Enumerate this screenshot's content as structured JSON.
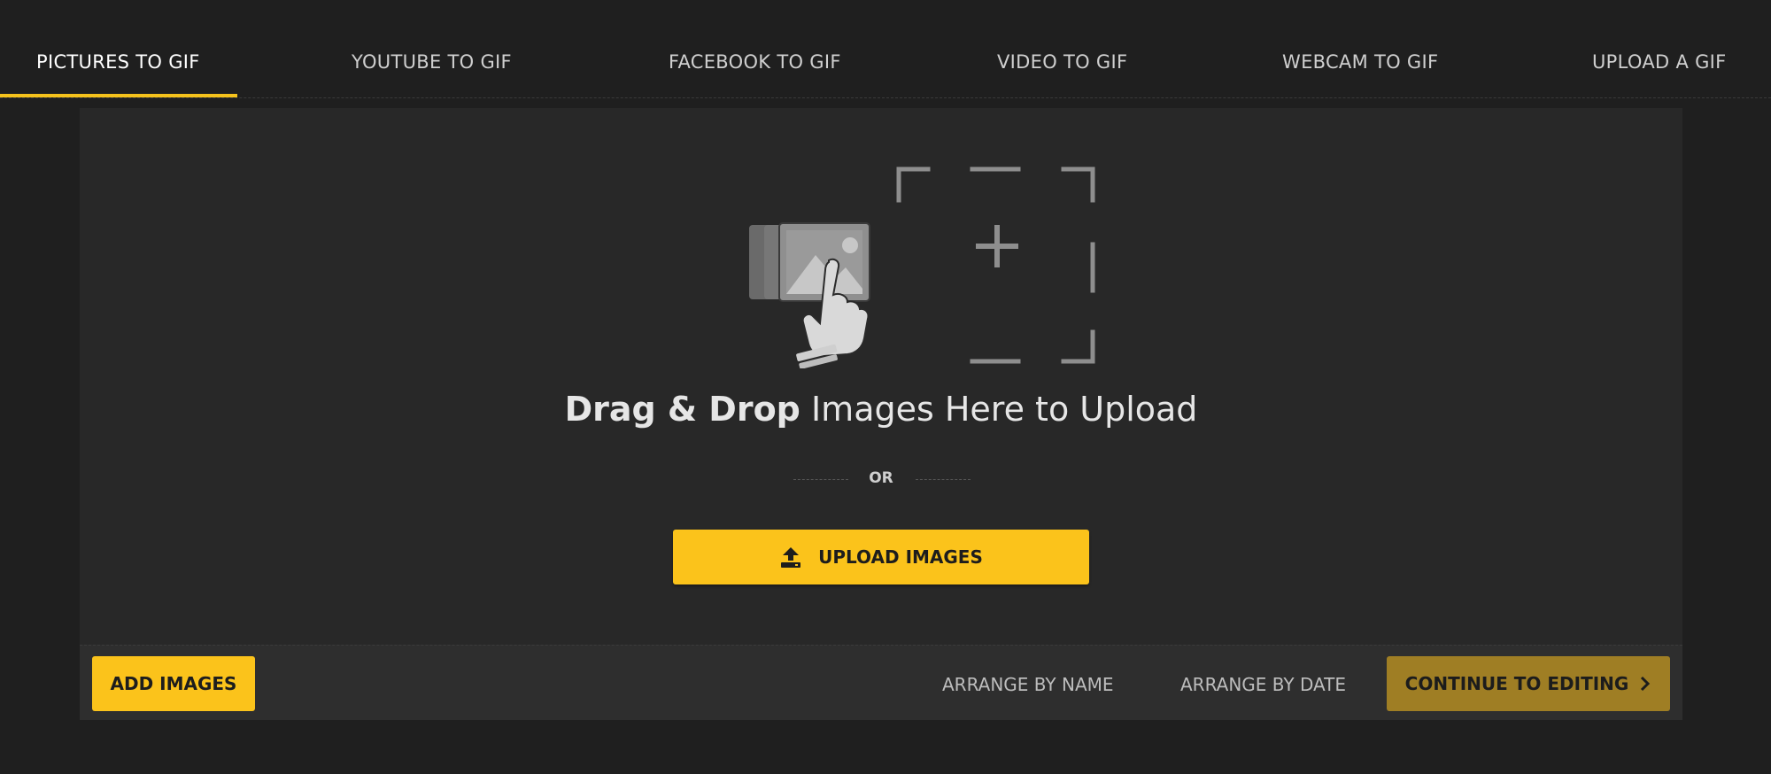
{
  "tabs": [
    {
      "label": "PICTURES TO GIF",
      "active": true
    },
    {
      "label": "YOUTUBE TO GIF",
      "active": false
    },
    {
      "label": "FACEBOOK TO GIF",
      "active": false
    },
    {
      "label": "VIDEO TO GIF",
      "active": false
    },
    {
      "label": "WEBCAM TO GIF",
      "active": false
    },
    {
      "label": "UPLOAD A GIF",
      "active": false
    }
  ],
  "dropzone": {
    "heading_strong": "Drag & Drop",
    "heading_rest": " Images Here to Upload",
    "or_text": "OR",
    "upload_button": "UPLOAD IMAGES",
    "upload_icon": "upload-icon"
  },
  "toolbar": {
    "add_images": "ADD IMAGES",
    "arrange_by_name": "ARRANGE BY NAME",
    "arrange_by_date": "ARRANGE BY DATE",
    "continue": "CONTINUE TO EDITING",
    "continue_icon": "chevron-right-icon"
  },
  "colors": {
    "accent": "#fbc31b",
    "continue_button": "#9f7e24",
    "panel": "#282828",
    "background": "#1f1f1f"
  }
}
